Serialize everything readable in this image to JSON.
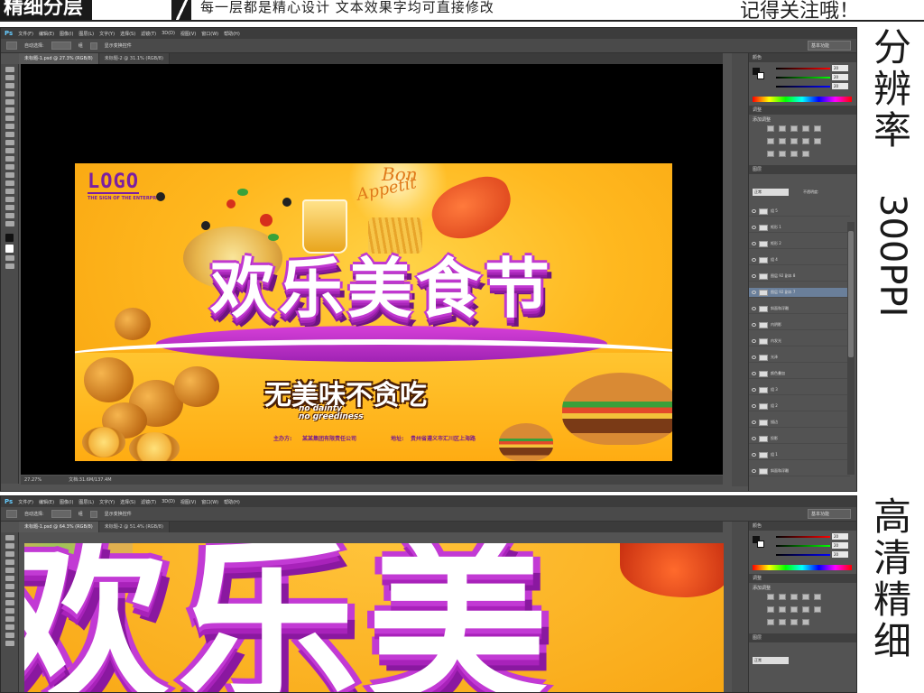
{
  "banner": {
    "title": "精细分层",
    "subtitle": "每一层都是精心设计   文本效果字均可直接修改",
    "right_text": "记得关注哦！"
  },
  "captions": {
    "resolution_chars": [
      "分",
      "辨",
      "率"
    ],
    "resolution_value": "300PPI",
    "hd_chars": [
      "高",
      "清",
      "精",
      "细"
    ]
  },
  "window_top": {
    "menu": [
      "文件(F)",
      "编辑(E)",
      "图像(I)",
      "图层(L)",
      "文字(Y)",
      "选择(S)",
      "滤镜(T)",
      "3D(D)",
      "视图(V)",
      "窗口(W)",
      "帮助(H)"
    ],
    "options": [
      "自动选择:",
      "组",
      "显示变换控件"
    ],
    "workspace": "基本功能",
    "tabs": [
      "未标题-1.psd @ 27.3% (RGB/8)",
      "未标题-2 @ 31.1% (RGB/8)"
    ],
    "zoom_level": "27.27%",
    "doc_size": "文档:31.6M/137.4M",
    "panels": {
      "color_head": "颜色",
      "rgb_values": [
        "20",
        "20",
        "20"
      ],
      "adjust_head": "调整",
      "adjust_label": "添加调整",
      "layers_head": "图层",
      "blend_mode": "正常",
      "opacity_label": "不透明度:",
      "layers": [
        "组 5",
        "矩形 1",
        "矩形 2",
        "组 4",
        "图层 92 副本 8",
        "图层 92 副本 7",
        "斜面和浮雕",
        "内阴影",
        "内发光",
        "光泽",
        "颜色叠加",
        "组 3",
        "组 2",
        "描边",
        "投影",
        "组 1",
        "斜面和浮雕"
      ]
    }
  },
  "window_bottom": {
    "menu": [
      "文件(F)",
      "编辑(E)",
      "图像(I)",
      "图层(L)",
      "文字(Y)",
      "选择(S)",
      "滤镜(T)",
      "3D(D)",
      "视图(V)",
      "窗口(W)",
      "帮助(H)"
    ],
    "options": [
      "自动选择:",
      "组",
      "显示变换控件"
    ],
    "workspace": "基本功能",
    "tabs": [
      "未标题-1.psd @ 64.3% (RGB/8)",
      "未标题-2 @ 51.4% (RGB/8)"
    ],
    "rgb_values": [
      "20",
      "20",
      "20"
    ],
    "adjust_label": "添加调整",
    "blend_mode": "正常",
    "zoom_text": "欢乐美"
  },
  "poster": {
    "logo": "LOGO",
    "logo_sub": "THE SIGN OF THE ENTERPRISE",
    "bon": "Bon",
    "appetit": "Appetit",
    "headline": "欢乐美食节",
    "slogan": "无美味不贪吃",
    "slogan_en_1": "no dainty",
    "slogan_en_2": "no greediness",
    "host": "主办方:",
    "host_name": "某某集团有限责任公司",
    "addr": "地址:",
    "addr_name": "贵州省遵义市汇川区上海路"
  },
  "colors": {
    "headline_purple": "#a826b8",
    "poster_yellow": "#ffb81f",
    "ps_chrome": "#535353"
  }
}
